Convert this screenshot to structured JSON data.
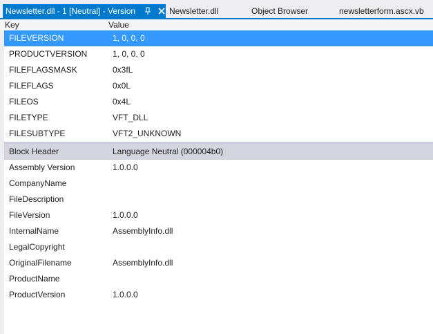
{
  "tabs": [
    {
      "label": "Newsletter.dll - 1 [Neutral] - Version",
      "active": true
    },
    {
      "label": "Newsletter.dll",
      "active": false
    },
    {
      "label": "Object Browser",
      "active": false
    },
    {
      "label": "newsletterform.ascx.vb",
      "active": false
    }
  ],
  "columns": {
    "key": "Key",
    "value": "Value"
  },
  "fixed_rows": [
    {
      "key": "FILEVERSION",
      "value": "1, 0, 0, 0",
      "selected": true
    },
    {
      "key": "PRODUCTVERSION",
      "value": "1, 0, 0, 0"
    },
    {
      "key": "FILEFLAGSMASK",
      "value": "0x3fL"
    },
    {
      "key": "FILEFLAGS",
      "value": "0x0L"
    },
    {
      "key": "FILEOS",
      "value": "0x4L"
    },
    {
      "key": "FILETYPE",
      "value": "VFT_DLL"
    },
    {
      "key": "FILESUBTYPE",
      "value": "VFT2_UNKNOWN"
    }
  ],
  "block_header": {
    "key": "Block Header",
    "value": "Language Neutral (000004b0)"
  },
  "string_rows": [
    {
      "key": "Assembly Version",
      "value": "1.0.0.0"
    },
    {
      "key": "CompanyName",
      "value": ""
    },
    {
      "key": "FileDescription",
      "value": ""
    },
    {
      "key": "FileVersion",
      "value": "1.0.0.0"
    },
    {
      "key": "InternalName",
      "value": "AssemblyInfo.dll"
    },
    {
      "key": "LegalCopyright",
      "value": ""
    },
    {
      "key": "OriginalFilename",
      "value": "AssemblyInfo.dll"
    },
    {
      "key": "ProductName",
      "value": ""
    },
    {
      "key": "ProductVersion",
      "value": "1.0.0.0"
    }
  ],
  "colors": {
    "accent": "#007acc",
    "selection": "#3399ff",
    "block_header_bg": "#d5d5df",
    "tab_strip_bg": "#eeeef2"
  },
  "icons": {
    "pin": "pin-icon",
    "close": "close-icon"
  }
}
